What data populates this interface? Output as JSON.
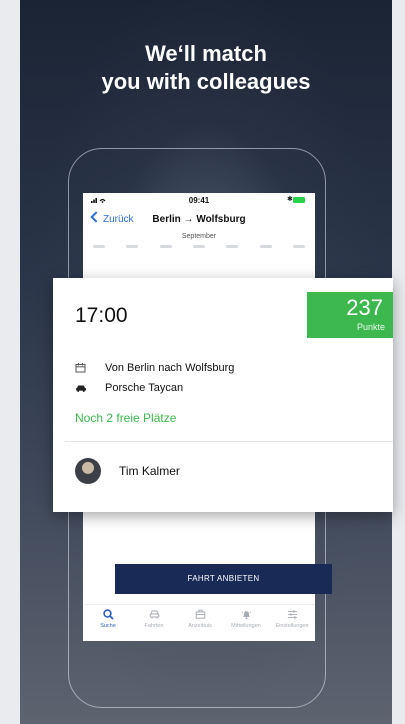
{
  "headline": {
    "line1": "We‘ll match",
    "line2": "you with colleagues"
  },
  "status_bar": {
    "time": "09:41",
    "battery_prefix": "✱"
  },
  "nav": {
    "back_label": "Zurück",
    "title": "Berlin → Wolfsburg"
  },
  "calendar": {
    "month": "September"
  },
  "ride_card": {
    "time": "17:00",
    "points_value": "237",
    "points_label": "Punkte",
    "route": "Von Berlin nach Wolfsburg",
    "car": "Porsche Taycan",
    "seats": "Noch 2 freie Plätze",
    "driver": "Tim Kalmer"
  },
  "offer_button": {
    "label": "FAHRT ANBIETEN"
  },
  "tabs": [
    {
      "label": "Suche",
      "icon": "search-icon",
      "active": true
    },
    {
      "label": "Fahrten",
      "icon": "car-icon",
      "active": false
    },
    {
      "label": "Anzeibuis",
      "icon": "briefcase-icon",
      "active": false
    },
    {
      "label": "Mitteilungen",
      "icon": "bell-icon",
      "active": false
    },
    {
      "label": "Einstellungen",
      "icon": "sliders-icon",
      "active": false
    }
  ],
  "colors": {
    "accent_green": "#3db84e",
    "button_navy": "#1a2a57",
    "link_blue": "#2f6fd0"
  }
}
